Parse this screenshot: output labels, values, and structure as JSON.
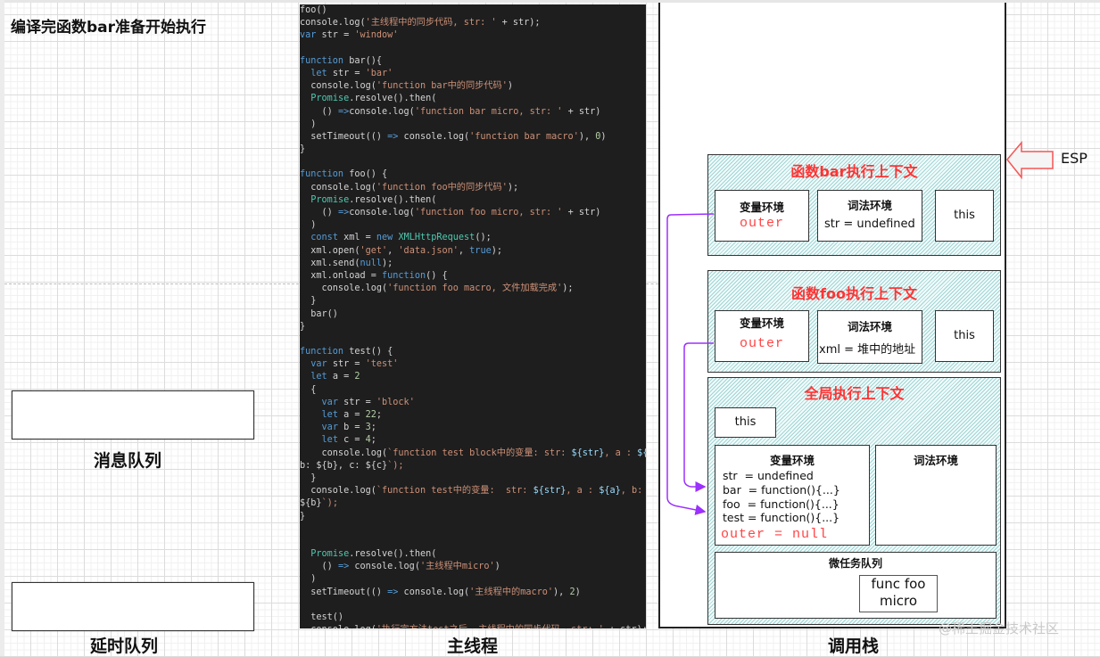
{
  "title": "编译完函数bar准备开始执行",
  "left_panel": {
    "message_queue_label": "消息队列",
    "delay_queue_label": "延时队列"
  },
  "main_thread": {
    "label": "主线程",
    "code_lines": [
      "foo()",
      "console.log('主线程中的同步代码, str: ' + str);",
      "var str = 'window'",
      "",
      "function bar(){",
      "  let str = 'bar'",
      "  console.log('function bar中的同步代码')",
      "  Promise.resolve().then(",
      "    () =>console.log('function bar micro, str: ' + str)",
      "  )",
      "  setTimeout(() => console.log('function bar macro'), 0)",
      "}",
      "",
      "function foo() {",
      "  console.log('function foo中的同步代码');",
      "  Promise.resolve().then(",
      "    () =>console.log('function foo micro, str: ' + str)",
      "  )",
      "  const xml = new XMLHttpRequest();",
      "  xml.open('get', 'data.json', true);",
      "  xml.send(null);",
      "  xml.onload = function() {",
      "    console.log('function foo macro, 文件加载完成');",
      "  }",
      "  bar()",
      "}",
      "",
      "function test() {",
      "  var str = 'test'",
      "  let a = 2",
      "  {",
      "    var str = 'block'",
      "    let a = 22;",
      "    var b = 3;",
      "    let c = 4;",
      "    console.log(`function test block中的变量: str: ${str}, a : ${a},",
      "b: ${b}, c: ${c}`);",
      "  }",
      "  console.log(`function test中的变量:  str: ${str}, a : ${a}, b:",
      "${b}`);",
      "}",
      "",
      "",
      "  Promise.resolve().then(",
      "    () => console.log('主线程中micro')",
      "  )",
      "  setTimeout(() => console.log('主线程中的macro'), 2)",
      "",
      "  test()",
      "  console.log('执行完方法test之后, 主线程中的同步代码, str: ' + str);"
    ]
  },
  "call_stack": {
    "label": "调用栈",
    "esp_label": "ESP",
    "bar_context": {
      "title": "函数bar执行上下文",
      "variable_env_title": "变量环境",
      "variable_env_outer": "outer",
      "lexical_env_title": "词法环境",
      "lexical_env_value": "str = undefined",
      "this_label": "this"
    },
    "foo_context": {
      "title": "函数foo执行上下文",
      "variable_env_title": "变量环境",
      "variable_env_outer": "outer",
      "lexical_env_title": "词法环境",
      "lexical_env_value": "xml = 堆中的地址",
      "this_label": "this"
    },
    "global_context": {
      "title": "全局执行上下文",
      "this_label": "this",
      "variable_env_title": "变量环境",
      "variable_env_values": [
        "str  = undefined",
        "bar  = function(){...}",
        "foo  = function(){...}",
        "test = function(){...}"
      ],
      "variable_env_outer": "outer = null",
      "lexical_env_title": "词法环境",
      "microtask_queue_title": "微任务队列",
      "microtask_items": [
        "func foo\nmicro"
      ]
    }
  },
  "watermark": "@稀土掘金技术社区",
  "colors": {
    "context_title": "#ff3333",
    "outer_text": "#ff4444",
    "arrow": "#9b30ff",
    "esp_arrow": "#f55555",
    "context_fill": "#bfe6e6",
    "code_bg": "#1e1e1e"
  }
}
